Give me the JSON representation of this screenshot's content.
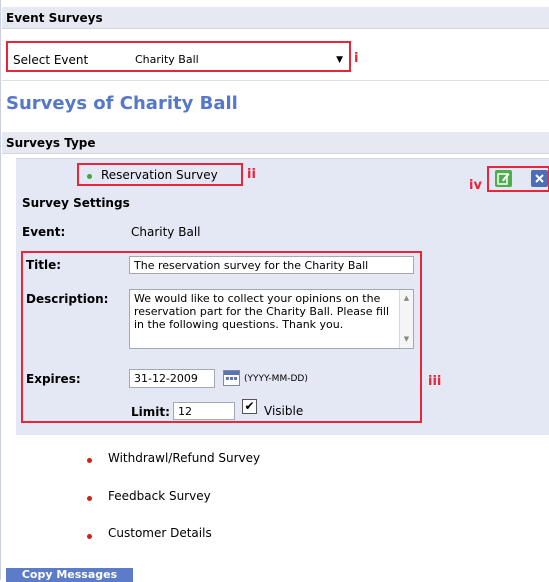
{
  "header": {
    "title": "Event Surveys"
  },
  "event_select": {
    "label": "Select Event",
    "value": "Charity Ball"
  },
  "page_title": "Surveys of Charity Ball",
  "surveys_type_heading": "Surveys Type",
  "surveys": [
    {
      "label": "Reservation Survey",
      "status_color": "#3aa83a"
    },
    {
      "label": "Withdrawl/Refund Survey",
      "status_color": "#d02020"
    },
    {
      "label": "Feedback Survey",
      "status_color": "#d02020"
    },
    {
      "label": "Customer Details",
      "status_color": "#d02020"
    }
  ],
  "settings": {
    "heading": "Survey Settings",
    "event_label": "Event:",
    "event_value": "Charity Ball",
    "title_label": "Title:",
    "title_value": "The reservation survey for the Charity Ball",
    "description_label": "Description:",
    "description_value": "We would like to collect your opinions on the reservation part for the Charity Ball. Please fill in the following questions. Thank you.",
    "expires_label": "Expires:",
    "expires_value": "31-12-2009",
    "date_format": "(YYYY-MM-DD)",
    "limit_label": "Limit:",
    "limit_value": "12",
    "visible_label": "Visible",
    "visible_checked": true
  },
  "callouts": {
    "i": "i",
    "ii": "ii",
    "iii": "iii",
    "iv": "iv"
  },
  "actions": {
    "edit_icon": "edit-icon",
    "delete_icon": "close-icon"
  },
  "footer": {
    "copy_button": "Copy Messages"
  },
  "colors": {
    "accent": "#5578c8",
    "callout": "#e8263a",
    "panel": "#e4e8f4"
  }
}
